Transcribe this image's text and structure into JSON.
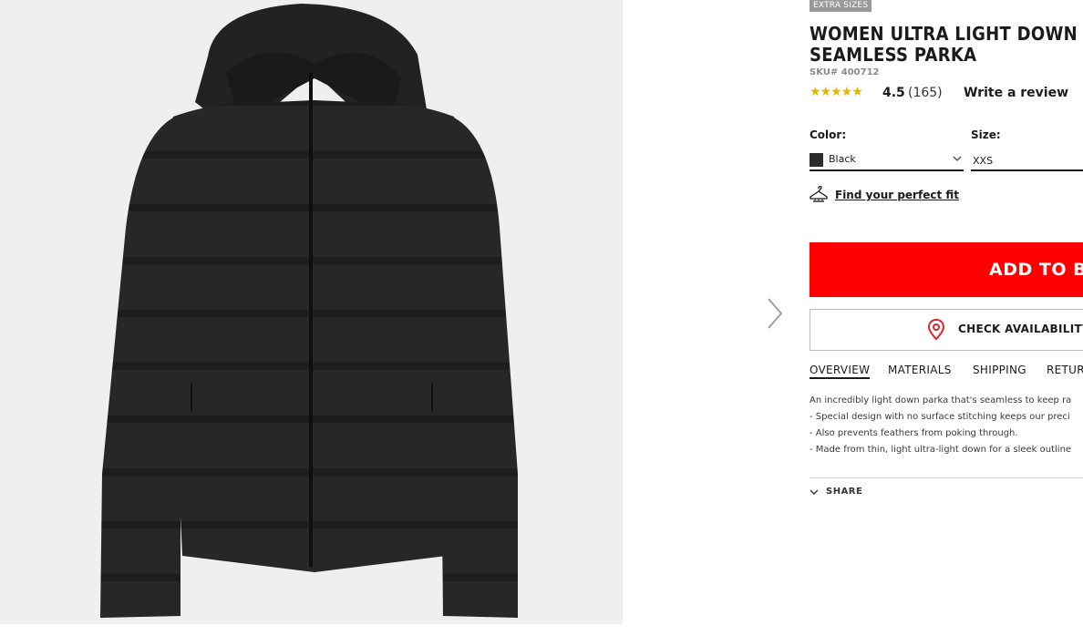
{
  "product": {
    "badge": "EXTRA SIZES",
    "title_line1": "WOMEN ULTRA LIGHT DOWN",
    "title_line2": "SEAMLESS PARKA",
    "sku": "SKU# 400712",
    "stars_glyph": "★★★★★",
    "rating": 4.5,
    "rating_text": "4.5",
    "review_count": "(165)",
    "write_review": "Write a review"
  },
  "options": {
    "color_label": "Color:",
    "color_value": "Black",
    "color_swatch": "#2c2c2c",
    "size_label": "Size:",
    "size_value": "XXS"
  },
  "fit": {
    "label": "Find your perfect fit",
    "icon": "hanger-icon"
  },
  "actions": {
    "add_to_bag": "ADD TO BA",
    "check_availability": "CHECK AVAILABILITY",
    "accent_color": "#ff0000"
  },
  "tabs": [
    {
      "label": "OVERVIEW",
      "active": true
    },
    {
      "label": "MATERIALS",
      "active": false
    },
    {
      "label": "SHIPPING",
      "active": false
    },
    {
      "label": "RETUR",
      "active": false
    }
  ],
  "description": [
    "An incredibly light down parka that's seamless to keep ra",
    "- Special design with no surface stitching keeps our preci",
    "- Also prevents feathers from poking through.",
    "- Made from thin, light ultra-light down for a sleek outline"
  ],
  "share": {
    "label": "SHARE"
  },
  "gallery": {
    "image": "black hooded down parka",
    "next_icon": "chevron-right-icon"
  }
}
